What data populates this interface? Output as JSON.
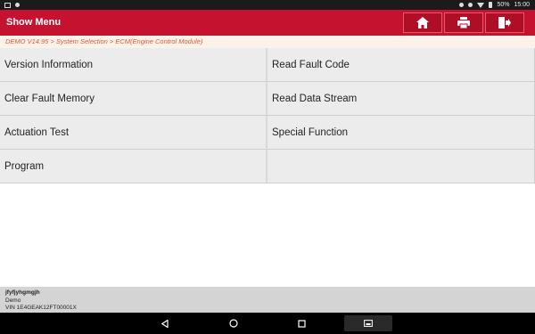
{
  "status_bar": {
    "battery": "50%",
    "time": "15:00"
  },
  "header": {
    "title": "Show Menu"
  },
  "breadcrumb": "DEMO V14.95 > System Selection > ECM(Engine Control Module)",
  "menu": {
    "items": [
      "Version Information",
      "Read Fault Code",
      "Clear Fault Memory",
      "Read Data Stream",
      "Actuation Test",
      "Special Function",
      "Program",
      ""
    ]
  },
  "vehicle": {
    "line1": "jfyfjyhgmgjh",
    "line2": "Demo",
    "line3": "VIN 1E4GEAK12FT00001X"
  },
  "colors": {
    "header_red": "#c4122f",
    "breadcrumb_text": "#e2582a"
  }
}
